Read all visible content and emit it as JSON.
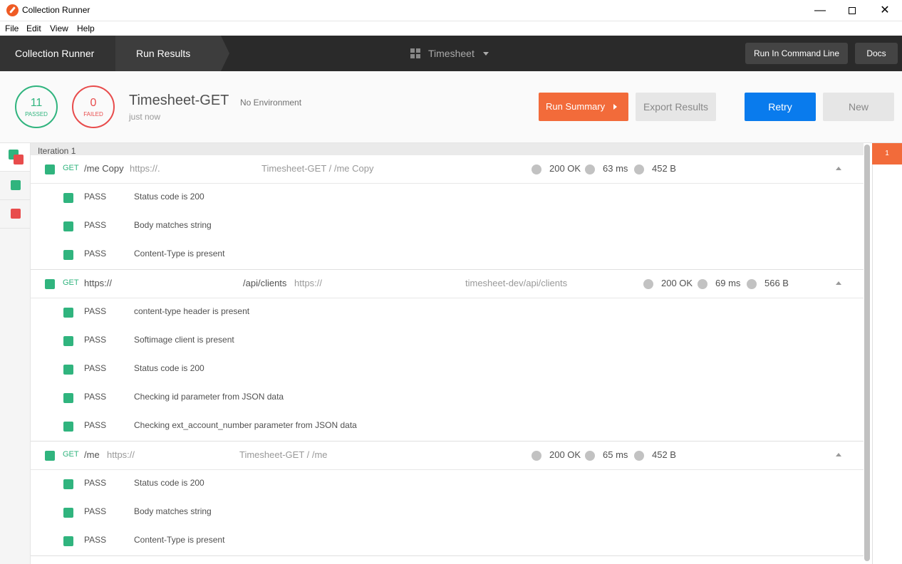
{
  "window": {
    "title": "Collection Runner",
    "minimize": "—",
    "close": "✕"
  },
  "menu": [
    "File",
    "Edit",
    "View",
    "Help"
  ],
  "nav": {
    "crumbs": [
      "Collection Runner",
      "Run Results"
    ],
    "workspace": "Timesheet",
    "run_cli": "Run In Command Line",
    "docs": "Docs"
  },
  "summary": {
    "passed_count": "11",
    "passed_label": "PASSED",
    "failed_count": "0",
    "failed_label": "FAILED",
    "collection": "Timesheet-GET",
    "environment": "No Environment",
    "time": "just now",
    "run_summary": "Run Summary",
    "export": "Export Results",
    "retry": "Retry",
    "new": "New"
  },
  "iteration_label": "Iteration 1",
  "right_badge": "1",
  "requests": [
    {
      "method": "GET",
      "name": "/me Copy",
      "url": "https://.",
      "path": "Timesheet-GET / /me Copy",
      "status": "200 OK",
      "time": "63 ms",
      "size": "452 B",
      "tests": [
        {
          "status": "PASS",
          "name": "Status code is 200"
        },
        {
          "status": "PASS",
          "name": "Body matches string"
        },
        {
          "status": "PASS",
          "name": "Content-Type is present"
        }
      ]
    },
    {
      "method": "GET",
      "name": "https://",
      "name2": "/api/clients",
      "url": "https://",
      "path": "timesheet-dev/api/clients",
      "status": "200 OK",
      "time": "69 ms",
      "size": "566 B",
      "tests": [
        {
          "status": "PASS",
          "name": "content-type header is present"
        },
        {
          "status": "PASS",
          "name": "Softimage client is present"
        },
        {
          "status": "PASS",
          "name": "Status code is 200"
        },
        {
          "status": "PASS",
          "name": "Checking id parameter from JSON data"
        },
        {
          "status": "PASS",
          "name": "Checking ext_account_number parameter from JSON data"
        }
      ]
    },
    {
      "method": "GET",
      "name": "/me",
      "url": "https://",
      "path": "Timesheet-GET / /me",
      "status": "200 OK",
      "time": "65 ms",
      "size": "452 B",
      "tests": [
        {
          "status": "PASS",
          "name": "Status code is 200"
        },
        {
          "status": "PASS",
          "name": "Body matches string"
        },
        {
          "status": "PASS",
          "name": "Content-Type is present"
        }
      ]
    }
  ]
}
